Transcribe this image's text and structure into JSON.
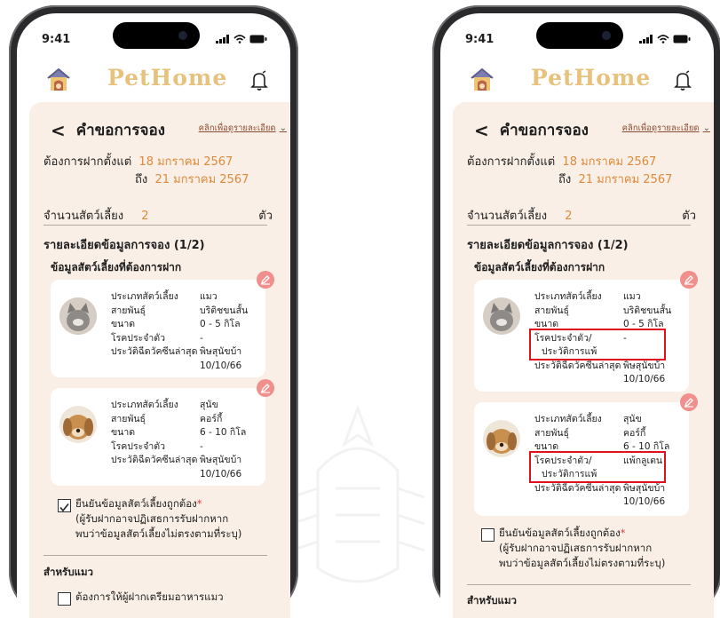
{
  "status": {
    "time": "9:41"
  },
  "app": {
    "brand": "PetHome"
  },
  "request": {
    "title": "คำขอการจอง",
    "detail_link": "คลิกเพื่อดูรายละเอียด",
    "from_label": "ต้องการฝากตั้งแต่",
    "from_date": "18 มกราคม 2567",
    "to_label": "ถึง",
    "to_date": "21 มกราคม 2567",
    "count_label": "จำนวนสัตว์เลี้ยง",
    "count_value": "2",
    "count_unit": "ตัว",
    "section_title": "รายละเอียดข้อมูลการจอง (1/2)",
    "pets_title": "ข้อมูลสัตว์เลี้ยงที่ต้องการฝาก"
  },
  "left": {
    "pets": [
      {
        "icon": "cat-photo",
        "fields": [
          {
            "k": "ประเภทสัตว์เลี้ยง",
            "v": "แมว"
          },
          {
            "k": "สายพันธุ์",
            "v": "บริติชขนสั้น"
          },
          {
            "k": "ขนาด",
            "v": "0 - 5 กิโล"
          },
          {
            "k": "โรคประจำตัว",
            "v": "-"
          },
          {
            "k": "ประวัติฉีดวัคซีนล่าสุด",
            "v": "พิษสุนัขบ้า"
          },
          {
            "k": "",
            "v": "10/10/66"
          }
        ]
      },
      {
        "icon": "dog-photo",
        "fields": [
          {
            "k": "ประเภทสัตว์เลี้ยง",
            "v": "สุนัข"
          },
          {
            "k": "สายพันธุ์",
            "v": "คอร์กี้"
          },
          {
            "k": "ขนาด",
            "v": "6 - 10 กิโล"
          },
          {
            "k": "โรคประจำตัว",
            "v": "-"
          },
          {
            "k": "ประวัติฉีดวัคซีนล่าสุด",
            "v": "พิษสุนัขบ้า"
          },
          {
            "k": "",
            "v": "10/10/66"
          }
        ]
      }
    ],
    "confirm_checked": true,
    "category": "สำหรับแมว",
    "food_option": "ต้องการให้ผู้ฝากเตรียมอาหารแมว"
  },
  "right": {
    "pets": [
      {
        "icon": "cat-photo",
        "fields": [
          {
            "k": "ประเภทสัตว์เลี้ยง",
            "v": "แมว"
          },
          {
            "k": "สายพันธุ์",
            "v": "บริติชขนสั้น"
          },
          {
            "k": "ขนาด",
            "v": "0 - 5 กิโล"
          },
          {
            "k": "โรคประจำตัว/",
            "v": "-"
          },
          {
            "k": "ประวัติการแพ้",
            "v": ""
          },
          {
            "k": "ประวัติฉีดวัคซีนล่าสุด",
            "v": "พิษสุนัขบ้า"
          },
          {
            "k": "",
            "v": "10/10/66"
          }
        ]
      },
      {
        "icon": "dog-photo",
        "fields": [
          {
            "k": "ประเภทสัตว์เลี้ยง",
            "v": "สุนัข"
          },
          {
            "k": "สายพันธุ์",
            "v": "คอร์กี้"
          },
          {
            "k": "ขนาด",
            "v": "6 - 10 กิโล"
          },
          {
            "k": "โรคประจำตัว/",
            "v": "แพ้กลูเตน"
          },
          {
            "k": "ประวัติการแพ้",
            "v": ""
          },
          {
            "k": "ประวัติฉีดวัคซีนล่าสุด",
            "v": "พิษสุนัขบ้า"
          },
          {
            "k": "",
            "v": "10/10/66"
          }
        ]
      }
    ],
    "confirm_checked": false,
    "category": "สำหรับแมว"
  },
  "confirm": {
    "label": "ยืนยันข้อมูลสัตว์เลี้ยงถูกต้อง",
    "required_mark": "*",
    "note_line1": "(ผู้รับฝากอาจปฏิเสธการรับฝากหาก",
    "note_line2": "พบว่าข้อมูลสัตว์เลี้ยงไม่ตรงตามที่ระบุ)"
  },
  "colors": {
    "accent": "#dd8a3a",
    "brand": "#e7c27d",
    "highlight": "#e0111b",
    "panel": "#faefe6"
  }
}
